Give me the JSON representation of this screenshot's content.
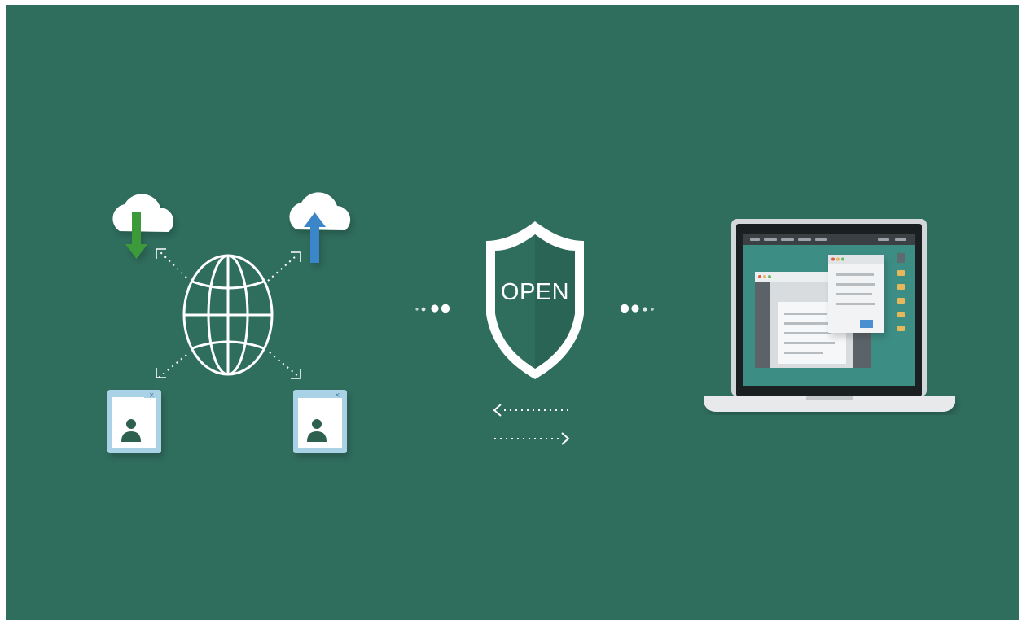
{
  "shield": {
    "label": "OPEN"
  },
  "colors": {
    "background": "#2f6d5d",
    "white": "#ffffff",
    "download_arrow": "#3d9a3a",
    "upload_arrow": "#3a86c8",
    "card_frame": "#a9d2e6",
    "laptop_screen_bg": "#3c8d84"
  },
  "icons": [
    "cloud-download-icon",
    "cloud-upload-icon",
    "globe-icon",
    "user-profile-window-icon",
    "shield-icon",
    "laptop-icon"
  ]
}
